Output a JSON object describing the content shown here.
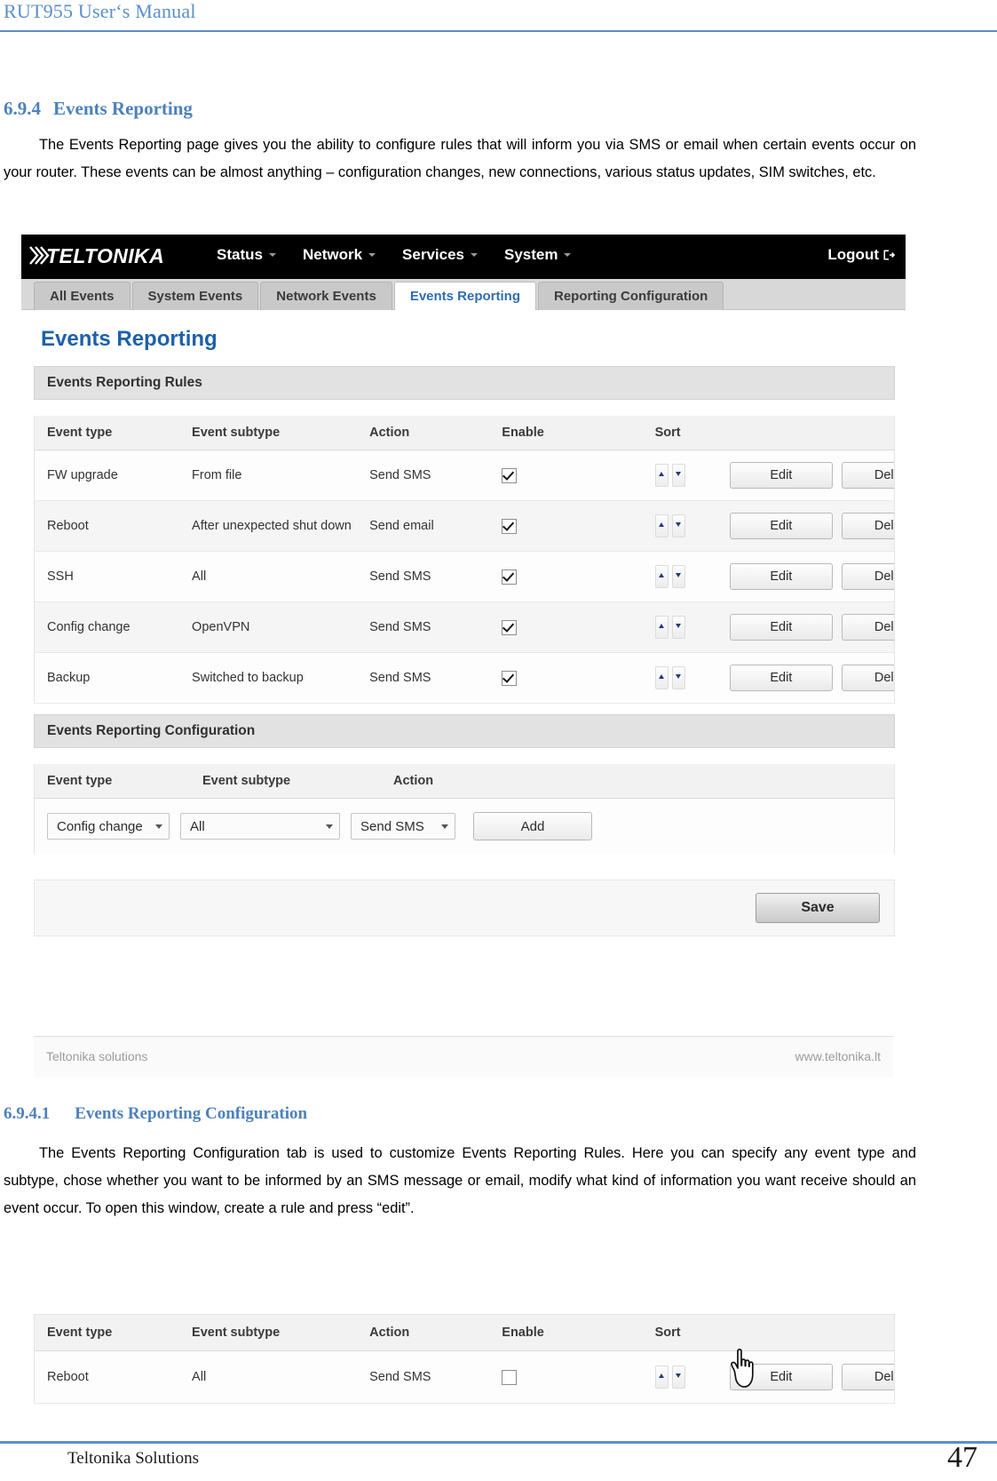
{
  "document": {
    "header_title": "RUT955 User‘s Manual",
    "footer_left": "Teltonika Solutions",
    "page_number": "47"
  },
  "section_694": {
    "number": "6.9.4",
    "title": "Events Reporting",
    "paragraph": "The Events Reporting page gives you the ability to configure rules that will inform you via SMS or email when certain events occur on your router. These events can be almost anything – configuration changes, new connections, various status updates, SIM switches, etc."
  },
  "section_6941": {
    "number": "6.9.4.1",
    "title": "Events Reporting Configuration",
    "paragraph": "The Events Reporting Configuration tab is used to customize Events Reporting Rules. Here you can specify any event type and subtype, chose whether you want to be informed by an SMS message or email, modify what kind of information you want receive should an event occur. To open this window, create a rule and press “edit”."
  },
  "router_ui": {
    "brand": "TELTONIKA",
    "nav": [
      {
        "label": "Status",
        "icon": "chevron-down-icon"
      },
      {
        "label": "Network",
        "icon": "chevron-down-icon"
      },
      {
        "label": "Services",
        "icon": "chevron-down-icon"
      },
      {
        "label": "System",
        "icon": "chevron-down-icon"
      }
    ],
    "logout_label": "Logout",
    "logout_icon": "logout-icon",
    "tabs": [
      {
        "label": "All Events",
        "active": false
      },
      {
        "label": "System Events",
        "active": false
      },
      {
        "label": "Network Events",
        "active": false
      },
      {
        "label": "Events Reporting",
        "active": true
      },
      {
        "label": "Reporting Configuration",
        "active": false
      }
    ],
    "page_title": "Events Reporting",
    "rules_section_title": "Events Reporting Rules",
    "rules_headers": {
      "event_type": "Event type",
      "event_subtype": "Event subtype",
      "action": "Action",
      "enable": "Enable",
      "sort": "Sort"
    },
    "rules_rows": [
      {
        "event_type": "FW upgrade",
        "event_subtype": "From file",
        "action": "Send SMS",
        "enable": true,
        "edit": "Edit",
        "delete": "Delete"
      },
      {
        "event_type": "Reboot",
        "event_subtype": "After unexpected shut down",
        "action": "Send email",
        "enable": true,
        "edit": "Edit",
        "delete": "Delete"
      },
      {
        "event_type": "SSH",
        "event_subtype": "All",
        "action": "Send SMS",
        "enable": true,
        "edit": "Edit",
        "delete": "Delete"
      },
      {
        "event_type": "Config change",
        "event_subtype": "OpenVPN",
        "action": "Send SMS",
        "enable": true,
        "edit": "Edit",
        "delete": "Delete"
      },
      {
        "event_type": "Backup",
        "event_subtype": "Switched to backup",
        "action": "Send SMS",
        "enable": true,
        "edit": "Edit",
        "delete": "Delete"
      }
    ],
    "config_section_title": "Events Reporting Configuration",
    "config_headers": {
      "event_type": "Event type",
      "event_subtype": "Event subtype",
      "action": "Action"
    },
    "config_form": {
      "event_type_value": "Config change",
      "event_subtype_value": "All",
      "action_value": "Send SMS",
      "add_label": "Add"
    },
    "save_label": "Save",
    "footer_left": "Teltonika solutions",
    "footer_right": "www.teltonika.lt"
  },
  "router_ui_small": {
    "headers": {
      "event_type": "Event type",
      "event_subtype": "Event subtype",
      "action": "Action",
      "enable": "Enable",
      "sort": "Sort"
    },
    "row": {
      "event_type": "Reboot",
      "event_subtype": "All",
      "action": "Send SMS",
      "enable": false,
      "edit": "Edit",
      "delete": "Delete"
    },
    "cursor_icon": "hand-pointer-cursor"
  },
  "colors": {
    "accent_blue": "#5b8fc9",
    "heading_blue": "#4d81bb",
    "ui_title_blue": "#1d60ab",
    "active_tab_blue": "#2f6cb4",
    "topbar_black": "#000000"
  }
}
